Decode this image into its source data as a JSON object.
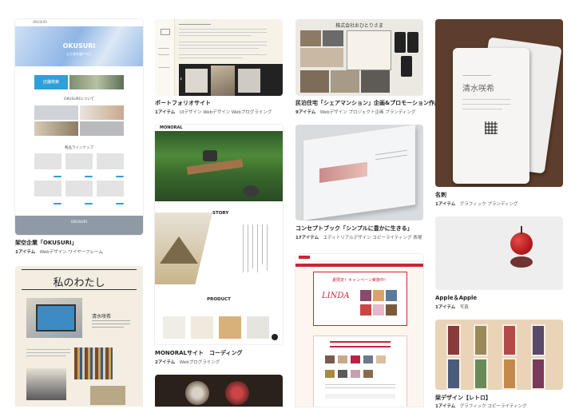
{
  "items": [
    {
      "title": "架空企業「OKUSURI」",
      "count": "1アイテム",
      "tags": "Webデザイン ワイヤーフレーム",
      "preview": {
        "brand": "OKUSURI",
        "hero_title": "OKUSURI",
        "hero_sub": "心と体を健やかに",
        "button": "店舗検索",
        "section": "OKUSURIについて",
        "products": "製品ラインナップ",
        "footer": "OKUSURI"
      }
    },
    {
      "title": "ポートフォリオサイト",
      "count": "1アイテム",
      "tags": "UIデザイン Webデザイン Webプログラミング"
    },
    {
      "title": "MONORALサイト　コーディング",
      "count": "2アイテム",
      "tags": "Webプログラミング",
      "preview": {
        "logo": "MONORAL",
        "story": "STORY",
        "product": "PRODUCT"
      }
    },
    {
      "title": "民泊住宅「シェアマンション」企画&プロモーション作成",
      "count": "9アイテム",
      "tags": "Webデザイン プロジェクト企画 プランディング",
      "preview": {
        "header": "株式会社おひとりさま"
      }
    },
    {
      "title": "コンセプトブック「シンプルに豊かに生きる」",
      "count": "17アイテム",
      "tags": "エディトリアルデザイン コピーライティング 表現"
    },
    {
      "title": "名刺",
      "count": "1アイテム",
      "tags": "グラフィック プランディング",
      "preview": {
        "name": "清水咲希"
      }
    },
    {
      "title": "Apple＆Apple",
      "count": "1アイテム",
      "tags": "写真"
    },
    {
      "title": "栞デザイン【レトロ】",
      "count": "1アイテム",
      "tags": "グラフィック コピーライティング"
    },
    {
      "title": "",
      "preview": {
        "heading": "私のわたし",
        "name": "清水咲希"
      }
    },
    {
      "title": "",
      "preview": {
        "brand": "LINDA",
        "headline": "夏限定！キャンペーン実施中！"
      }
    }
  ],
  "colors": {
    "accent_blue": "#2f9fd8",
    "okusuri_hero": "#a8c8ea",
    "linda_red": "#c8253a",
    "card_beige": "#f3ede2",
    "apple_red": "#b71c1c",
    "wood": "#6b4a36"
  }
}
